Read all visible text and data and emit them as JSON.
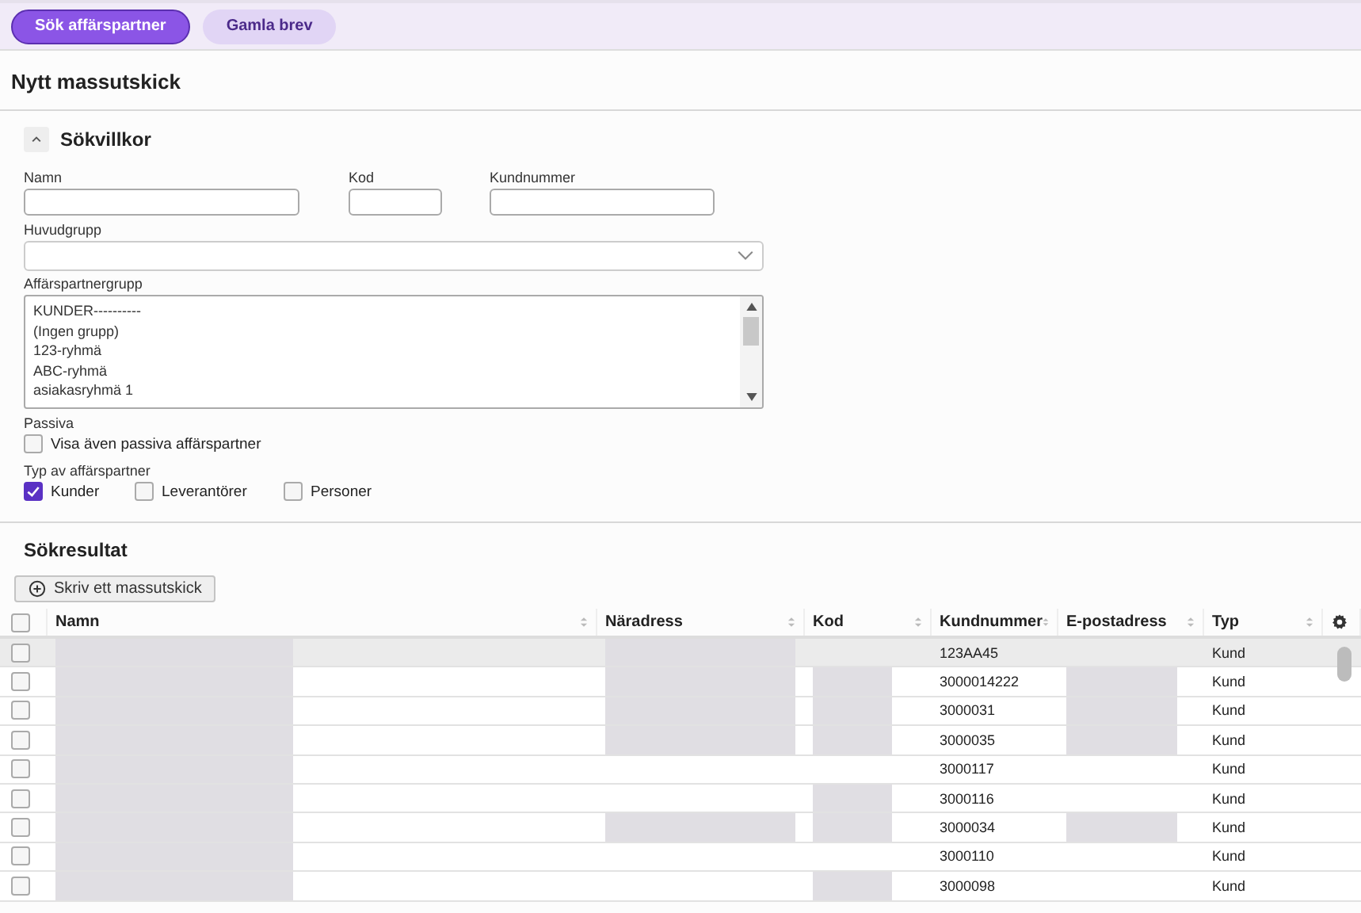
{
  "top_tabs": [
    {
      "label": "Sök affärspartner",
      "selected": true
    },
    {
      "label": "Gamla brev",
      "selected": false
    }
  ],
  "page_title": "Nytt massutskick",
  "search_section": {
    "title": "Sökvillkor",
    "expanded": true,
    "fields": [
      {
        "label": "Namn",
        "kind": "text"
      },
      {
        "label": "Kod",
        "kind": "text"
      },
      {
        "label": "Kundnummer",
        "kind": "text"
      }
    ],
    "main_group": {
      "label": "Huvudgrupp"
    },
    "partner_group": {
      "label": "Affärspartnergrupp",
      "options": [
        "KUNDER----------",
        "(Ingen grupp)",
        "123-ryhmä",
        "ABC-ryhmä",
        "asiakasryhmä 1"
      ]
    },
    "passive": {
      "label": "Passiva",
      "option": {
        "label": "Visa även passiva affärspartner",
        "checked": false
      }
    },
    "partner_type": {
      "label": "Typ av affärspartner",
      "options": [
        {
          "label": "Kunder",
          "checked": true
        },
        {
          "label": "Leverantörer",
          "checked": false
        },
        {
          "label": "Personer",
          "checked": false
        }
      ]
    }
  },
  "results": {
    "title": "Sökresultat",
    "action_button": "Skriv ett massutskick",
    "select_all": {
      "checked": false
    },
    "columns": [
      "Namn",
      "Näradress",
      "Kod",
      "Kundnummer",
      "E-postadress",
      "Typ"
    ],
    "rows": [
      {
        "selected": true,
        "checked": false,
        "redacted": [
          true,
          true,
          false,
          false
        ],
        "customer_number": "123AA45",
        "type": "Kund"
      },
      {
        "selected": false,
        "checked": false,
        "redacted": [
          true,
          true,
          true,
          true
        ],
        "customer_number": "3000014222",
        "type": "Kund"
      },
      {
        "selected": false,
        "checked": false,
        "redacted": [
          true,
          true,
          true,
          true
        ],
        "customer_number": "3000031",
        "type": "Kund"
      },
      {
        "selected": false,
        "checked": false,
        "redacted": [
          true,
          true,
          true,
          true
        ],
        "customer_number": "3000035",
        "type": "Kund"
      },
      {
        "selected": false,
        "checked": false,
        "redacted": [
          true,
          false,
          false,
          false
        ],
        "customer_number": "3000117",
        "type": "Kund"
      },
      {
        "selected": false,
        "checked": false,
        "redacted": [
          true,
          false,
          true,
          false
        ],
        "customer_number": "3000116",
        "type": "Kund"
      },
      {
        "selected": false,
        "checked": false,
        "redacted": [
          true,
          true,
          true,
          true
        ],
        "customer_number": "3000034",
        "type": "Kund"
      },
      {
        "selected": false,
        "checked": false,
        "redacted": [
          true,
          false,
          false,
          false
        ],
        "customer_number": "3000110",
        "type": "Kund"
      },
      {
        "selected": false,
        "checked": false,
        "redacted": [
          true,
          false,
          true,
          false
        ],
        "customer_number": "3000098",
        "type": "Kund"
      }
    ]
  }
}
